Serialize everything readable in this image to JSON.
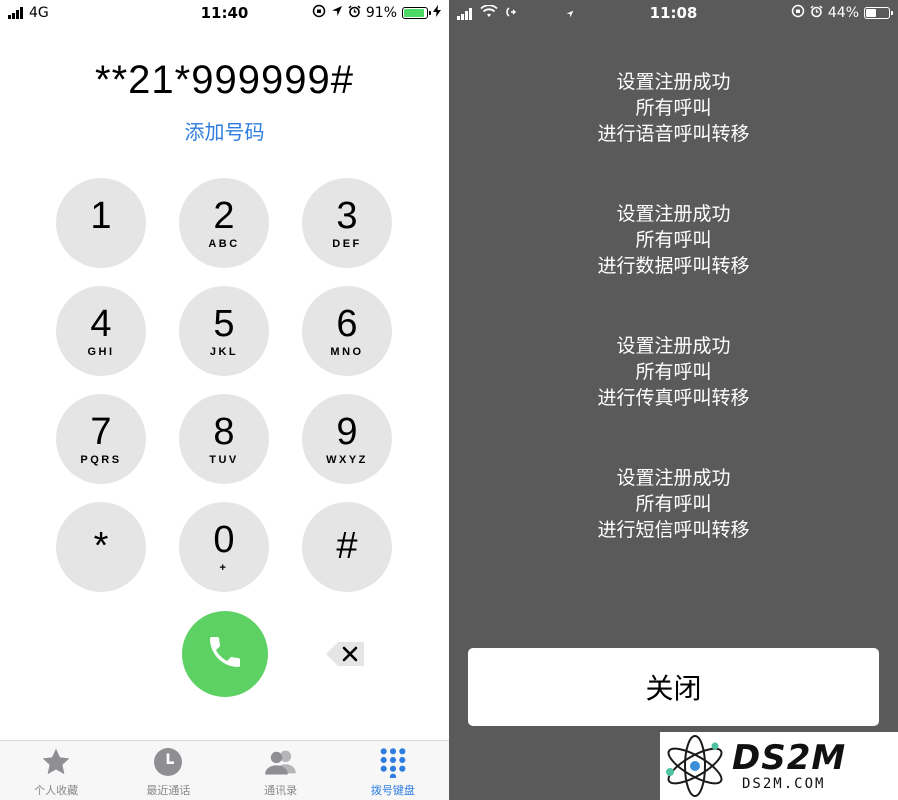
{
  "colors": {
    "accent_blue": "#2f7de1",
    "call_green": "#5ed164",
    "key_gray": "#e5e5e5",
    "right_bg": "#5a5a5a",
    "battery_green": "#4cd964"
  },
  "left_status": {
    "carrier": "4G",
    "time": "11:40",
    "battery": "91%",
    "battery_level": 0.91,
    "icons": [
      "signal-icon",
      "screen-lock-icon",
      "location-icon",
      "alarm-icon",
      "battery-icon",
      "charging-icon"
    ]
  },
  "dialer": {
    "dialed_number": "**21*999999#",
    "add_number": "添加号码",
    "keys": [
      {
        "digit": "1",
        "letters": ""
      },
      {
        "digit": "2",
        "letters": "ABC"
      },
      {
        "digit": "3",
        "letters": "DEF"
      },
      {
        "digit": "4",
        "letters": "GHI"
      },
      {
        "digit": "5",
        "letters": "JKL"
      },
      {
        "digit": "6",
        "letters": "MNO"
      },
      {
        "digit": "7",
        "letters": "PQRS"
      },
      {
        "digit": "8",
        "letters": "TUV"
      },
      {
        "digit": "9",
        "letters": "WXYZ"
      },
      {
        "digit": "*",
        "letters": ""
      },
      {
        "digit": "0",
        "letters": "+"
      },
      {
        "digit": "#",
        "letters": ""
      }
    ]
  },
  "tabs": [
    {
      "label": "个人收藏",
      "icon": "star-icon",
      "active": false
    },
    {
      "label": "最近通话",
      "icon": "clock-icon",
      "active": false
    },
    {
      "label": "通讯录",
      "icon": "contacts-icon",
      "active": false
    },
    {
      "label": "拨号键盘",
      "icon": "keypad-icon",
      "active": true
    }
  ],
  "right_status": {
    "time": "11:08",
    "battery": "44%",
    "battery_level": 0.44,
    "icons": [
      "signal-icon",
      "wifi-icon",
      "sync-icon",
      "location-icon",
      "screen-lock-icon",
      "alarm-icon",
      "battery-icon"
    ]
  },
  "result": {
    "messages": [
      {
        "line1": "设置注册成功",
        "line2": "所有呼叫",
        "line3": "进行语音呼叫转移"
      },
      {
        "line1": "设置注册成功",
        "line2": "所有呼叫",
        "line3": "进行数据呼叫转移"
      },
      {
        "line1": "设置注册成功",
        "line2": "所有呼叫",
        "line3": "进行传真呼叫转移"
      },
      {
        "line1": "设置注册成功",
        "line2": "所有呼叫",
        "line3": "进行短信呼叫转移"
      }
    ],
    "close_label": "关闭"
  },
  "watermark": {
    "big": "DS2M",
    "small": "DS2M.COM"
  }
}
